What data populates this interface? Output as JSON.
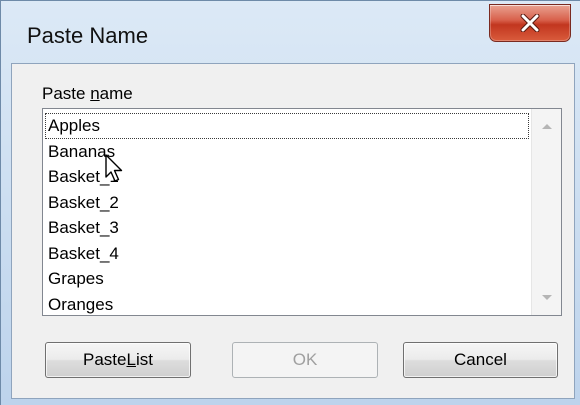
{
  "window": {
    "title": "Paste Name"
  },
  "paste_name_label": {
    "before": "Paste ",
    "mnemonic": "n",
    "after": "ame"
  },
  "names": [
    "Apples",
    "Bananas",
    "Basket_1",
    "Basket_2",
    "Basket_3",
    "Basket_4",
    "Grapes",
    "Oranges"
  ],
  "buttons": {
    "paste_list": {
      "before": "Paste ",
      "mnemonic": "L",
      "after": "ist"
    },
    "ok": "OK",
    "cancel": "Cancel"
  },
  "colors": {
    "close_button": "#c2361f",
    "frame": "#c9dcf0",
    "client_bg": "#f0f0f0"
  },
  "icons": {
    "close": "close-icon",
    "scroll_up": "scroll-up-arrow-icon",
    "scroll_down": "scroll-down-arrow-icon",
    "cursor": "mouse-pointer-icon"
  }
}
